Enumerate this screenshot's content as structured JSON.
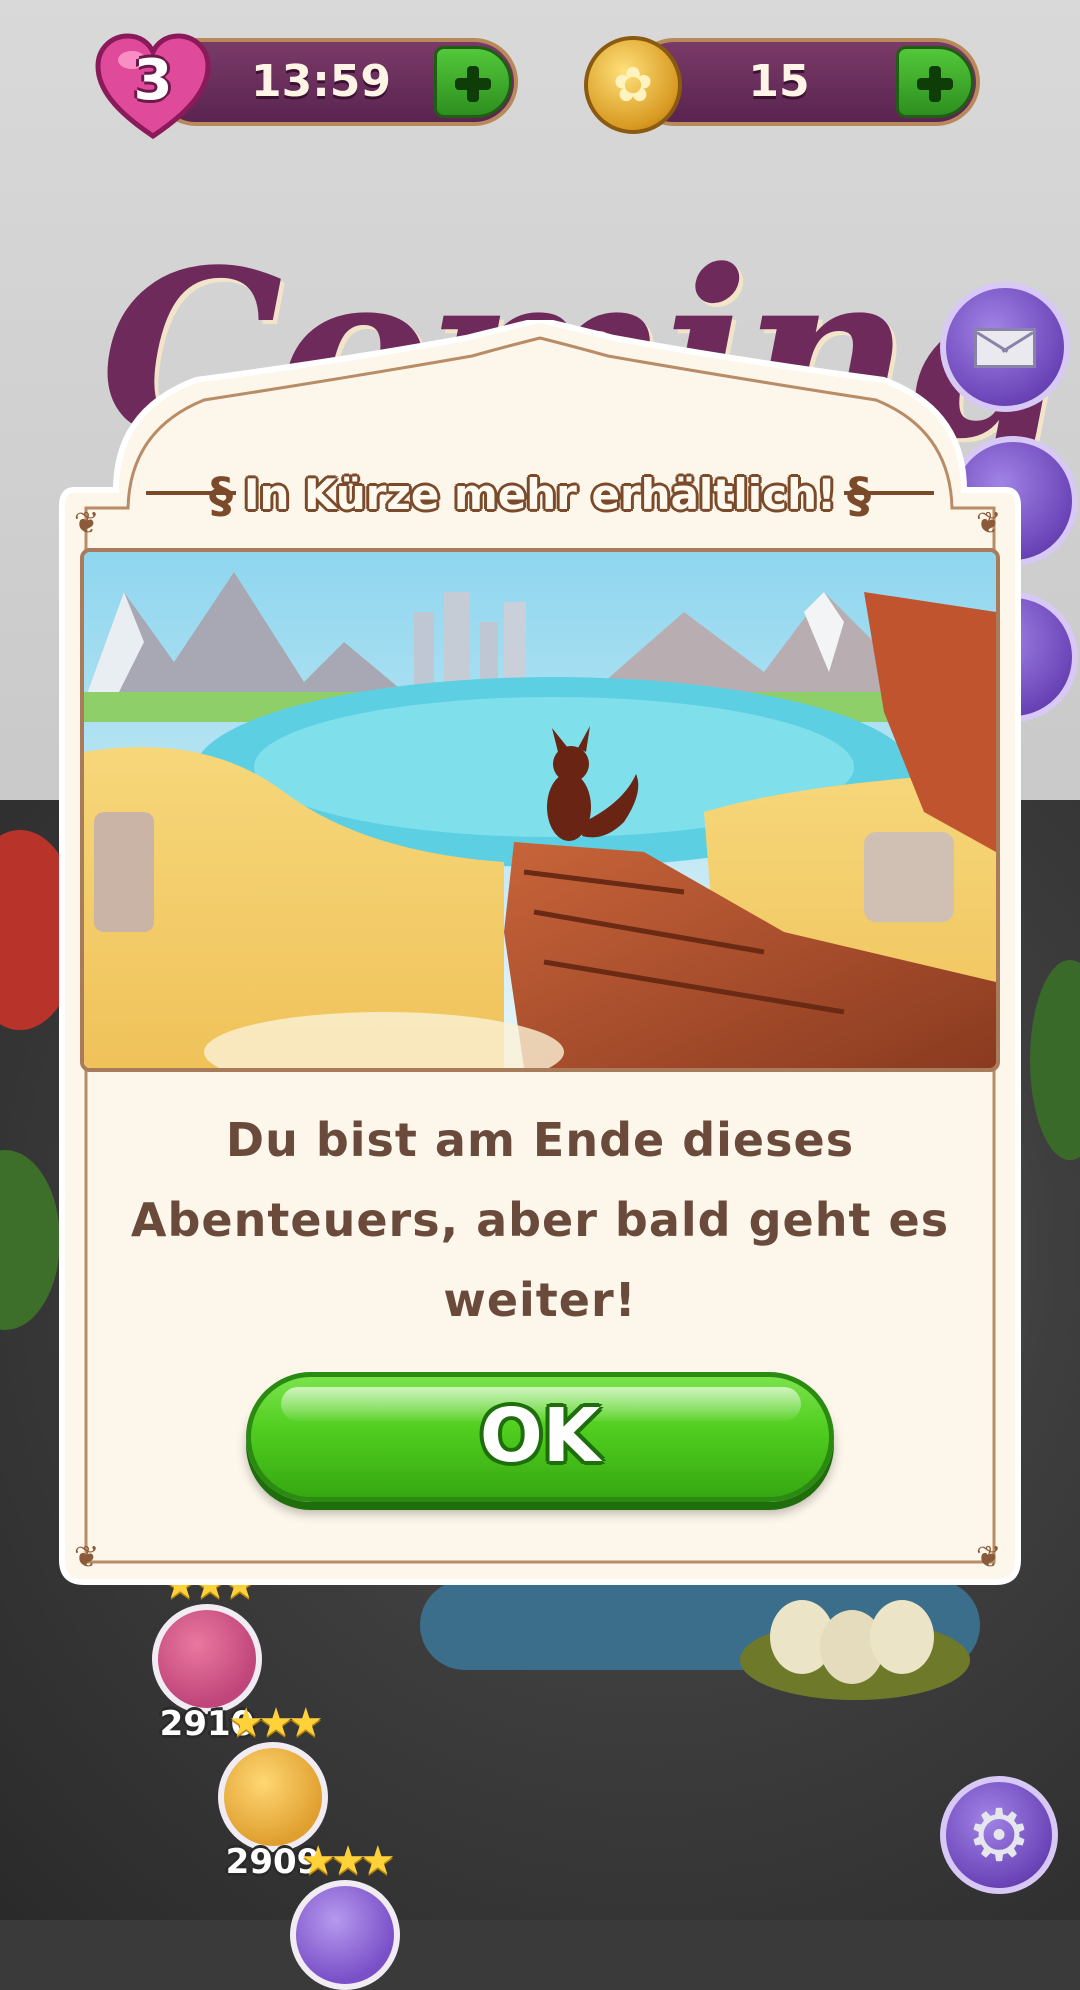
{
  "hud": {
    "lives": "3",
    "life_timer": "13:59",
    "coins": "15"
  },
  "background": {
    "title_fragment": "Coming"
  },
  "modal": {
    "title": "In Kürze mehr erhältlich!",
    "message": "Du bist am Ende dieses Abenteuers, aber bald geht es weiter!",
    "ok_label": "OK"
  },
  "map": {
    "levels": [
      {
        "number": "2910",
        "color": "#c0457a"
      },
      {
        "number": "2909",
        "color": "#e0a030"
      }
    ]
  },
  "icons": {
    "heart": "heart-icon",
    "coin": "coin-icon",
    "plus": "plus-icon",
    "mail": "envelope-icon",
    "settings": "gear-icon"
  },
  "colors": {
    "hud_bar": "#6a2e5e",
    "plus_button": "#3fae2a",
    "ok_button": "#4fcd1e",
    "modal_bg": "#fdf6ea",
    "modal_border": "#a87c5a",
    "text_brown": "#6a4a3a"
  }
}
